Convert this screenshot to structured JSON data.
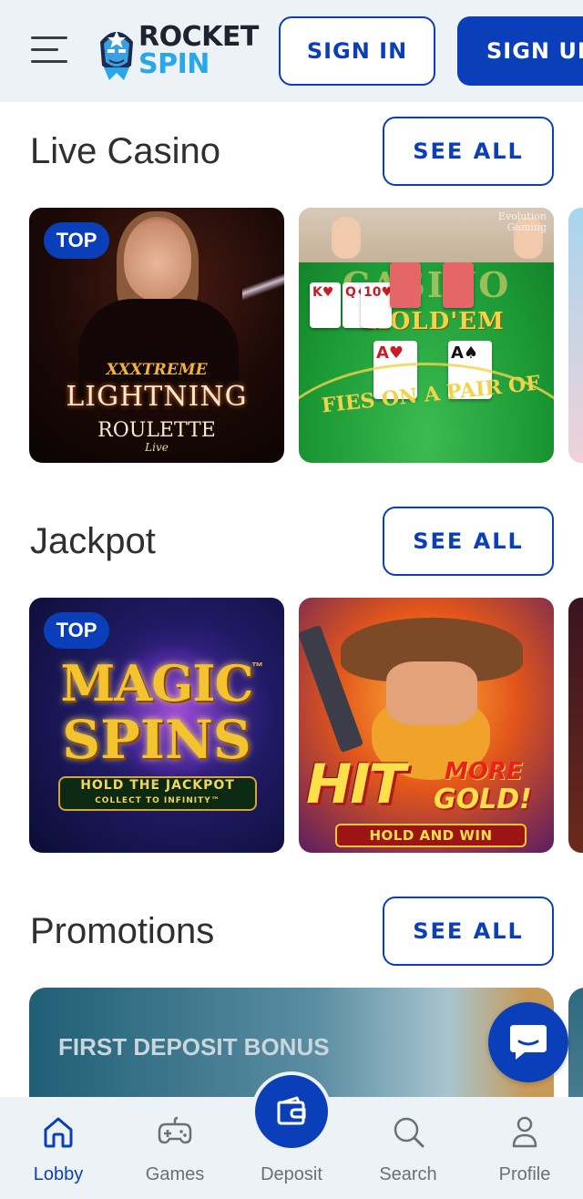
{
  "header": {
    "logo_line1": "ROCKET",
    "logo_line2": "SPIN",
    "sign_in_label": "SIGN IN",
    "sign_up_label": "SIGN UP"
  },
  "sections": [
    {
      "title": "Live Casino",
      "see_all_label": "SEE ALL",
      "cards": [
        {
          "badge": "TOP",
          "art": {
            "line1": "XXXTREME",
            "line2": "LIGHTNING",
            "line3": "ROULETTE",
            "line4": "Live"
          }
        },
        {
          "badge": "",
          "art": {
            "line1": "CASINO",
            "line2": "HOLD'EM",
            "line3": "FIES ON A PAIR OF",
            "brand": "Evolution Gaming"
          }
        }
      ]
    },
    {
      "title": "Jackpot",
      "see_all_label": "SEE ALL",
      "cards": [
        {
          "badge": "TOP",
          "art": {
            "line1": "MAGIC",
            "line2": "SPINS",
            "line3": "HOLD THE JACKPOT",
            "line4": "COLLECT TO INFINITY™",
            "tm": "™"
          }
        },
        {
          "badge": "",
          "art": {
            "line1": "HIT",
            "line2": "MORE",
            "line3": "GOLD!",
            "line4": "HOLD AND WIN"
          }
        }
      ]
    },
    {
      "title": "Promotions",
      "see_all_label": "SEE ALL",
      "promo_text": "FIRST DEPOSIT BONUS"
    }
  ],
  "bottom_nav": {
    "items": [
      {
        "label": "Lobby",
        "icon": "home-icon",
        "active": true
      },
      {
        "label": "Games",
        "icon": "gamepad-icon",
        "active": false
      },
      {
        "label": "Deposit",
        "icon": "wallet-icon",
        "active": false
      },
      {
        "label": "Search",
        "icon": "search-icon",
        "active": false
      },
      {
        "label": "Profile",
        "icon": "user-icon",
        "active": false
      }
    ]
  },
  "colors": {
    "brand_blue": "#0b3fb9",
    "header_bg": "#ecf2f6",
    "logo_cyan": "#2aa7e8"
  }
}
